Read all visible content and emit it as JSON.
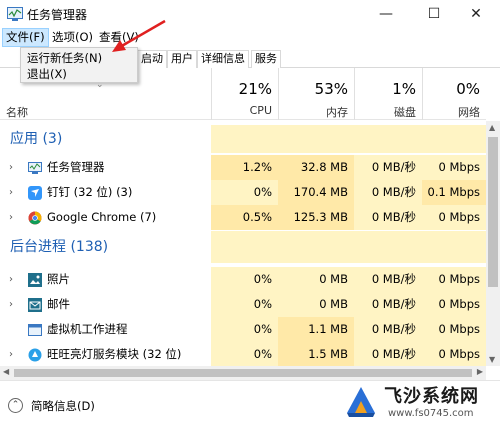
{
  "window": {
    "title": "任务管理器",
    "minimize": "—",
    "maximize": "☐",
    "close": "✕"
  },
  "menu": {
    "file": "文件(F)",
    "options": "选项(O)",
    "view": "查看(V)"
  },
  "file_menu": {
    "run_new_task": "运行新任务(N)",
    "exit": "退出(X)"
  },
  "tabs": [
    {
      "label": "启动"
    },
    {
      "label": "用户"
    },
    {
      "label": "详细信息"
    },
    {
      "label": "服务"
    }
  ],
  "columns": {
    "name": "名称",
    "cpu": {
      "pct": "21%",
      "label": "CPU"
    },
    "memory": {
      "pct": "53%",
      "label": "内存"
    },
    "disk": {
      "pct": "1%",
      "label": "磁盘"
    },
    "network": {
      "pct": "0%",
      "label": "网络"
    }
  },
  "groups": {
    "apps": "应用 (3)",
    "background": "后台进程 (138)"
  },
  "rows": [
    {
      "name": "任务管理器",
      "cpu": "1.2%",
      "mem": "32.8 MB",
      "disk": "0 MB/秒",
      "net": "0 Mbps",
      "icon": "task-manager-icon"
    },
    {
      "name": "钉钉 (32 位) (3)",
      "cpu": "0%",
      "mem": "170.4 MB",
      "disk": "0 MB/秒",
      "net": "0.1 Mbps",
      "icon": "dingtalk-icon"
    },
    {
      "name": "Google Chrome (7)",
      "cpu": "0.5%",
      "mem": "125.3 MB",
      "disk": "0 MB/秒",
      "net": "0 Mbps",
      "icon": "chrome-icon"
    },
    {
      "name": "照片",
      "cpu": "0%",
      "mem": "0 MB",
      "disk": "0 MB/秒",
      "net": "0 Mbps",
      "icon": "photos-icon"
    },
    {
      "name": "邮件",
      "cpu": "0%",
      "mem": "0 MB",
      "disk": "0 MB/秒",
      "net": "0 Mbps",
      "icon": "mail-icon"
    },
    {
      "name": "虚拟机工作进程",
      "cpu": "0%",
      "mem": "1.1 MB",
      "disk": "0 MB/秒",
      "net": "0 Mbps",
      "icon": "vm-process-icon"
    },
    {
      "name": "旺旺亮灯服务模块 (32 位)",
      "cpu": "0%",
      "mem": "1.5 MB",
      "disk": "0 MB/秒",
      "net": "0 Mbps",
      "icon": "wangwang-icon"
    }
  ],
  "footer": {
    "fewer_details": "简略信息(D)"
  },
  "watermark": {
    "title": "飞沙系统网",
    "url": "www.fs0745.com"
  },
  "colors": {
    "accent_blue": "#1e5fb3",
    "heat_light": "#fff4c4",
    "heat_mid": "#ffe9a8",
    "annotation_red": "#e02020"
  }
}
